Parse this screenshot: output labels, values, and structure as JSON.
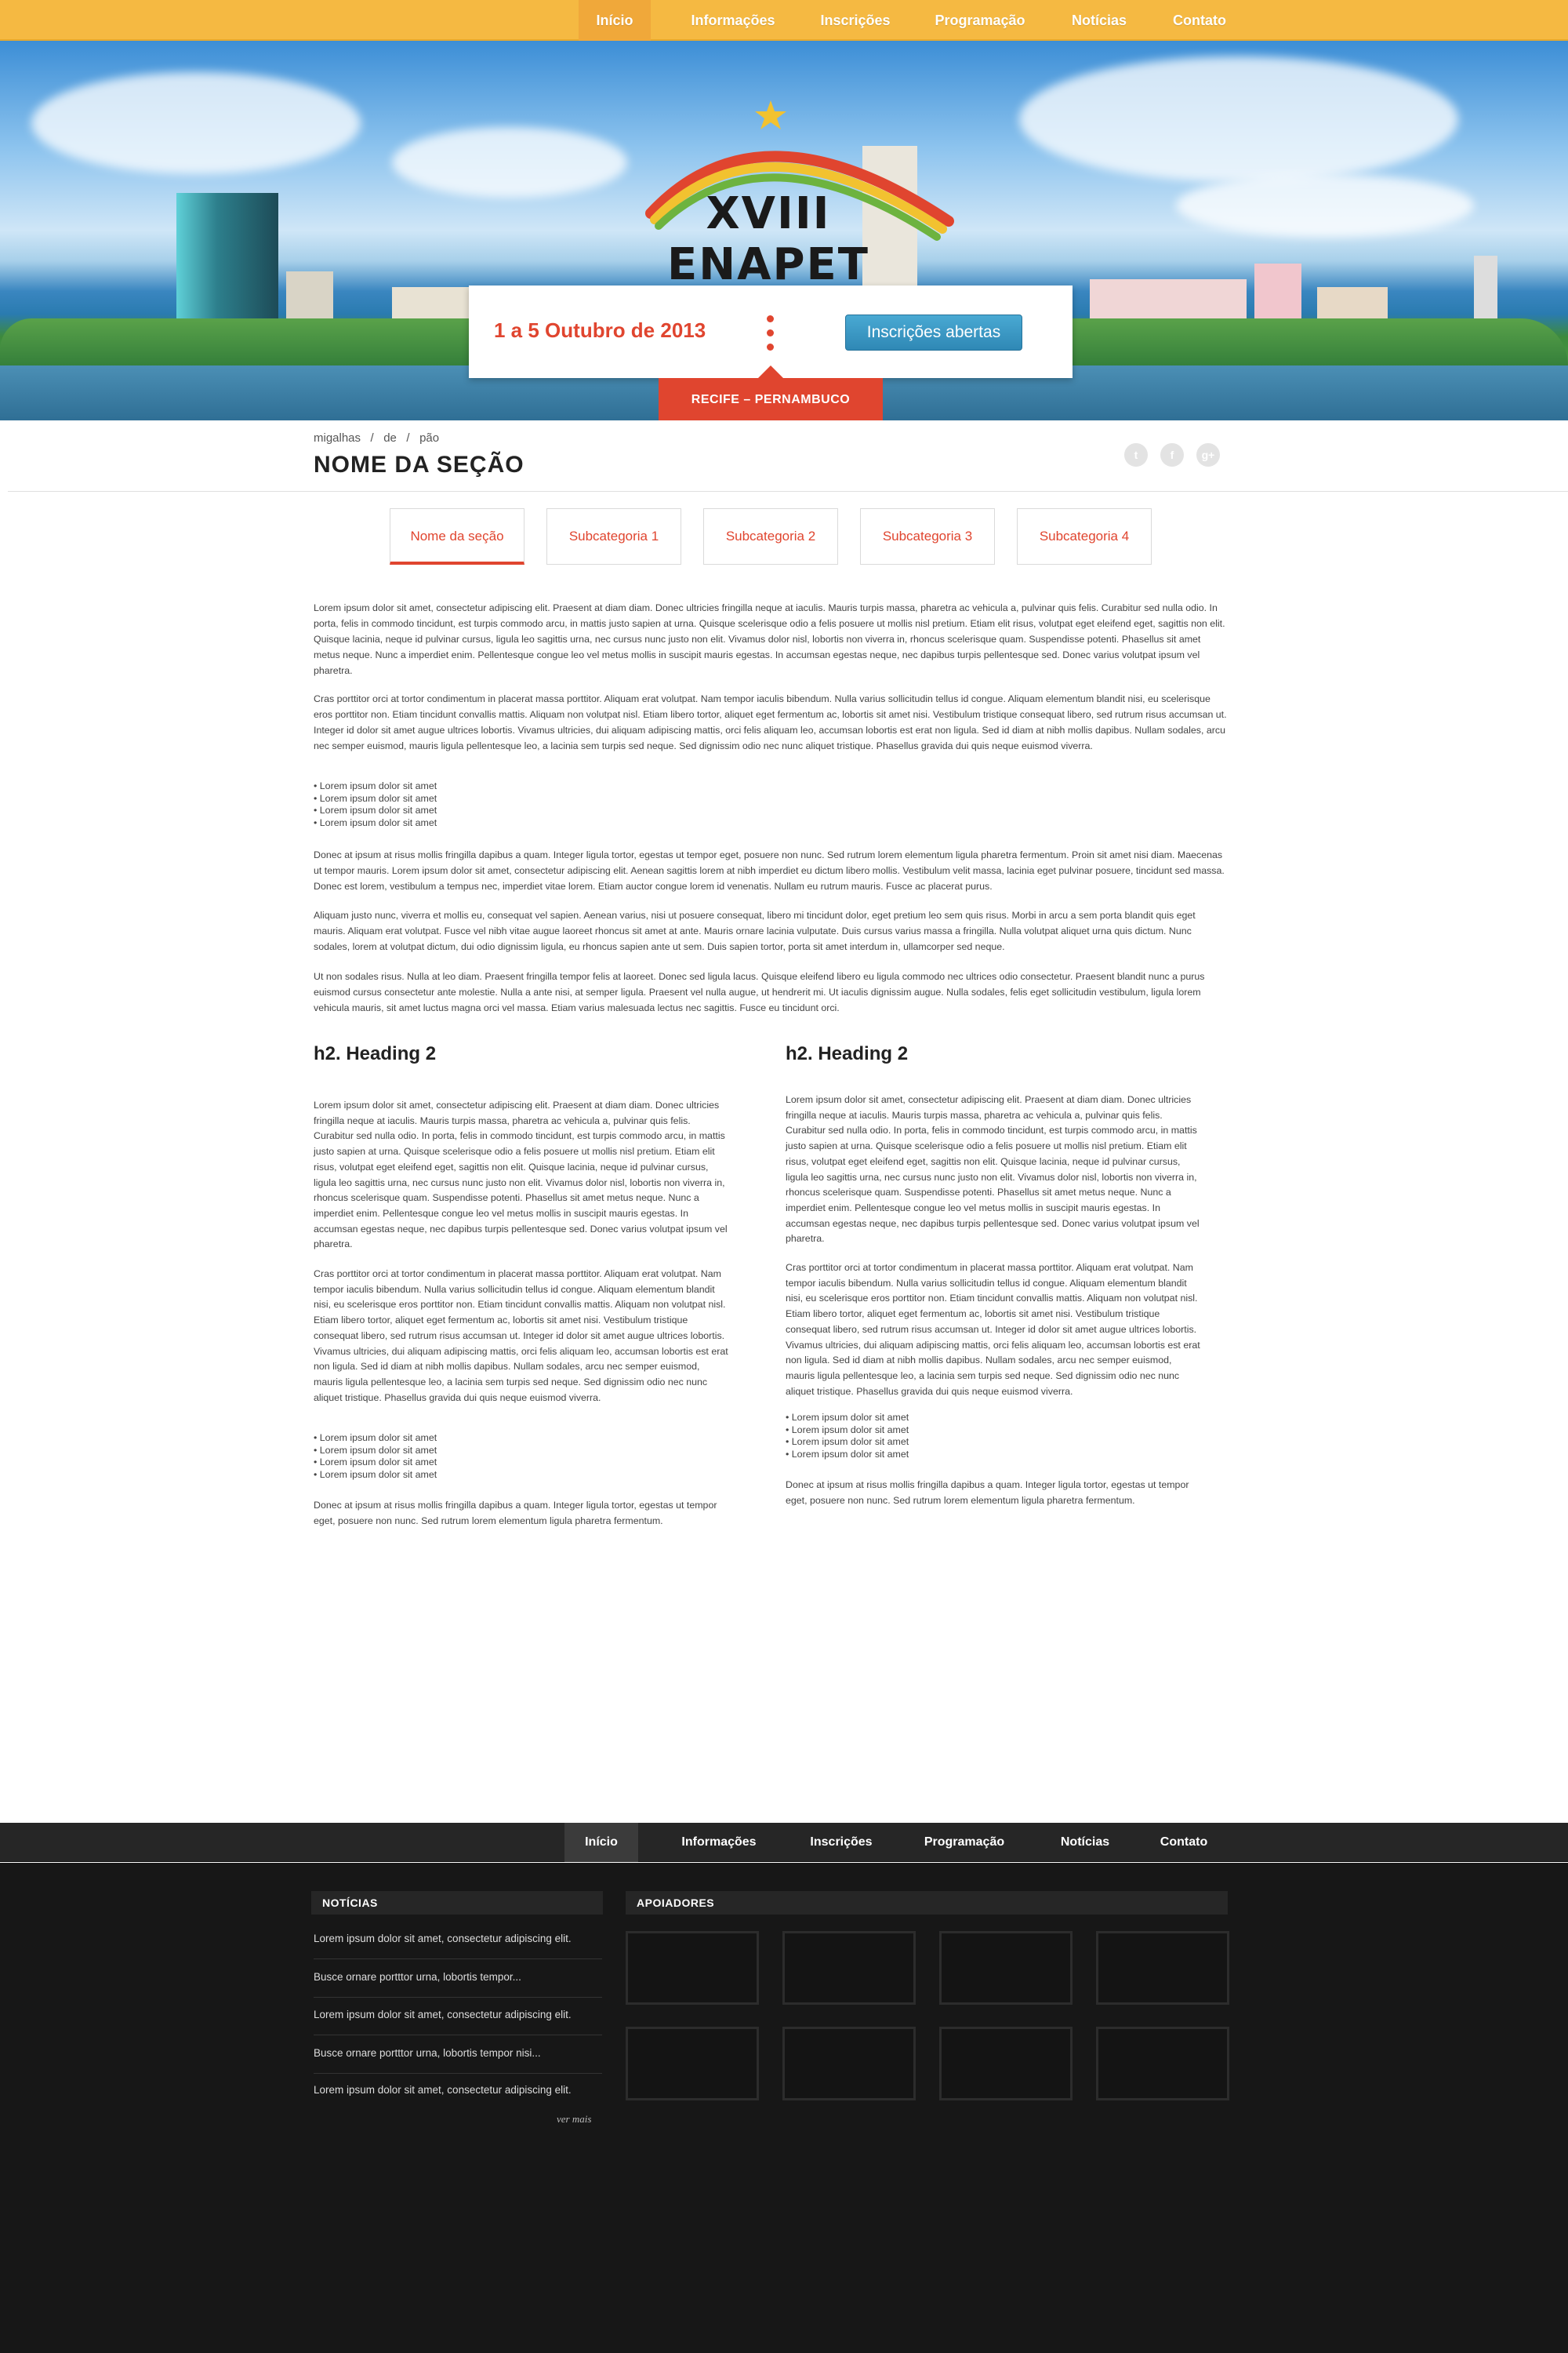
{
  "nav": [
    {
      "label": "Início",
      "active": true
    },
    {
      "label": "Informações"
    },
    {
      "label": "Inscrições"
    },
    {
      "label": "Programação"
    },
    {
      "label": "Notícias"
    },
    {
      "label": "Contato"
    }
  ],
  "hero": {
    "logo_text": "XVIII ENAPET",
    "date": "1 a 5 Outubro de 2013",
    "cta": "Inscrições abertas",
    "location": "RECIFE – PERNAMBUCO"
  },
  "breadcrumb": [
    "migalhas",
    "de",
    "pão"
  ],
  "section_title": "NOME DA SEÇÃO",
  "social_icons": [
    "twitter-icon",
    "facebook-icon",
    "googleplus-icon"
  ],
  "tabs": [
    "Nome da seção",
    "Subcategoria 1",
    "Subcategoria 2",
    "Subcategoria 3",
    "Subcategoria 4"
  ],
  "body": {
    "p1": "Lorem ipsum dolor sit amet, consectetur adipiscing elit. Praesent at diam diam. Donec ultricies fringilla neque at iaculis. Mauris turpis massa, pharetra ac vehicula a, pulvinar quis felis. Curabitur sed nulla odio. In porta, felis in commodo tincidunt, est turpis commodo arcu, in mattis justo sapien at urna. Quisque scelerisque odio a felis posuere ut mollis nisl pretium. Etiam elit risus, volutpat eget eleifend eget, sagittis non elit. Quisque lacinia, neque id pulvinar cursus, ligula leo sagittis urna, nec cursus nunc justo non elit. Vivamus dolor nisl, lobortis non viverra in, rhoncus scelerisque quam. Suspendisse potenti. Phasellus sit amet metus neque. Nunc a imperdiet enim. Pellentesque congue leo vel metus mollis in suscipit mauris egestas. In accumsan egestas neque, nec dapibus turpis pellentesque sed. Donec varius volutpat ipsum vel pharetra.",
    "p2": "Cras porttitor orci at tortor condimentum in placerat massa porttitor. Aliquam erat volutpat. Nam tempor iaculis bibendum. Nulla varius sollicitudin tellus id congue. Aliquam elementum blandit nisi, eu scelerisque eros porttitor non. Etiam tincidunt convallis mattis. Aliquam non volutpat nisl. Etiam libero tortor, aliquet eget fermentum ac, lobortis sit amet nisi. Vestibulum tristique consequat libero, sed rutrum risus accumsan ut. Integer id dolor sit amet augue ultrices lobortis. Vivamus ultricies, dui aliquam adipiscing mattis, orci felis aliquam leo, accumsan lobortis est erat non ligula. Sed id diam at nibh mollis dapibus. Nullam sodales, arcu nec semper euismod, mauris ligula pellentesque leo, a lacinia sem turpis sed neque. Sed dignissim odio nec nunc aliquet tristique. Phasellus gravida dui quis neque euismod viverra.",
    "bullets": [
      "• Lorem ipsum dolor sit amet",
      "• Lorem ipsum dolor sit amet",
      "• Lorem ipsum dolor sit amet",
      "• Lorem ipsum dolor sit amet"
    ],
    "p3": "Donec at ipsum at risus mollis fringilla dapibus a quam. Integer ligula tortor, egestas ut tempor eget, posuere non nunc. Sed rutrum lorem elementum ligula pharetra fermentum. Proin sit amet nisi diam. Maecenas ut tempor mauris. Lorem ipsum dolor sit amet, consectetur adipiscing elit. Aenean sagittis lorem at nibh imperdiet eu dictum libero mollis. Vestibulum velit massa, lacinia eget pulvinar posuere, tincidunt sed massa. Donec est lorem, vestibulum a tempus nec, imperdiet vitae lorem. Etiam auctor congue lorem id venenatis. Nullam eu rutrum mauris. Fusce ac placerat purus.",
    "p4": "Aliquam justo nunc, viverra et mollis eu, consequat vel sapien. Aenean varius, nisi ut posuere consequat, libero mi tincidunt dolor, eget pretium leo sem quis risus. Morbi in arcu a sem porta blandit quis eget mauris. Aliquam erat volutpat. Fusce vel nibh vitae augue laoreet rhoncus sit amet at ante. Mauris ornare lacinia vulputate. Duis cursus varius massa a fringilla. Nulla volutpat aliquet urna quis dictum. Nunc sodales, lorem at volutpat dictum, dui odio dignissim ligula, eu rhoncus sapien ante ut sem. Duis sapien tortor, porta sit amet interdum in, ullamcorper sed neque.",
    "p5": "Ut non sodales risus. Nulla at leo diam. Praesent fringilla tempor felis at laoreet. Donec sed ligula lacus. Quisque eleifend libero eu ligula commodo nec ultrices odio consectetur. Praesent blandit nunc a purus euismod cursus consectetur ante molestie. Nulla a ante nisi, at semper ligula. Praesent vel nulla augue, ut hendrerit mi. Ut iaculis dignissim augue. Nulla sodales, felis eget sollicitudin vestibulum, ligula lorem vehicula mauris, sit amet luctus magna orci vel massa. Etiam varius malesuada lectus nec sagittis. Fusce eu tincidunt orci."
  },
  "columns": [
    {
      "heading": "h2. Heading 2",
      "p1": "Lorem ipsum dolor sit amet, consectetur adipiscing elit. Praesent at diam diam. Donec ultricies fringilla neque at iaculis. Mauris turpis massa, pharetra ac vehicula a, pulvinar quis felis. Curabitur sed nulla odio. In porta, felis in commodo tincidunt, est turpis commodo arcu, in mattis justo sapien at urna. Quisque scelerisque odio a felis posuere ut mollis nisl pretium. Etiam elit risus, volutpat eget eleifend eget, sagittis non elit. Quisque lacinia, neque id pulvinar cursus, ligula leo sagittis urna, nec cursus nunc justo non elit. Vivamus dolor nisl, lobortis non viverra in, rhoncus scelerisque quam. Suspendisse potenti. Phasellus sit amet metus neque. Nunc a imperdiet enim. Pellentesque congue leo vel metus mollis in suscipit mauris egestas. In accumsan egestas neque, nec dapibus turpis pellentesque sed. Donec varius volutpat ipsum vel pharetra.",
      "p2": "Cras porttitor orci at tortor condimentum in placerat massa porttitor. Aliquam erat volutpat. Nam tempor iaculis bibendum. Nulla varius sollicitudin tellus id congue. Aliquam elementum blandit nisi, eu scelerisque eros porttitor non. Etiam tincidunt convallis mattis. Aliquam non volutpat nisl. Etiam libero tortor, aliquet eget fermentum ac, lobortis sit amet nisi. Vestibulum tristique consequat libero, sed rutrum risus accumsan ut. Integer id dolor sit amet augue ultrices lobortis. Vivamus ultricies, dui aliquam adipiscing mattis, orci felis aliquam leo, accumsan lobortis est erat non ligula. Sed id diam at nibh mollis dapibus. Nullam sodales, arcu nec semper euismod, mauris ligula pellentesque leo, a lacinia sem turpis sed neque. Sed dignissim odio nec nunc aliquet tristique. Phasellus gravida dui quis neque euismod viverra.",
      "bullets": [
        "• Lorem ipsum dolor sit amet",
        "• Lorem ipsum dolor sit amet",
        "• Lorem ipsum dolor sit amet",
        "• Lorem ipsum dolor sit amet"
      ],
      "p3": "Donec at ipsum at risus mollis fringilla dapibus a quam. Integer ligula tortor, egestas ut tempor eget, posuere non nunc. Sed rutrum lorem elementum ligula pharetra fermentum."
    },
    {
      "heading": "h2. Heading 2",
      "p1": "Lorem ipsum dolor sit amet, consectetur adipiscing elit. Praesent at diam diam. Donec ultricies fringilla neque at iaculis. Mauris turpis massa, pharetra ac vehicula a, pulvinar quis felis. Curabitur sed nulla odio. In porta, felis in commodo tincidunt, est turpis commodo arcu, in mattis justo sapien at urna. Quisque scelerisque odio a felis posuere ut mollis nisl pretium. Etiam elit risus, volutpat eget eleifend eget, sagittis non elit. Quisque lacinia, neque id pulvinar cursus, ligula leo sagittis urna, nec cursus nunc justo non elit. Vivamus dolor nisl, lobortis non viverra in, rhoncus scelerisque quam. Suspendisse potenti. Phasellus sit amet metus neque. Nunc a imperdiet enim. Pellentesque congue leo vel metus mollis in suscipit mauris egestas. In accumsan egestas neque, nec dapibus turpis pellentesque sed. Donec varius volutpat ipsum vel pharetra.",
      "p2": "Cras porttitor orci at tortor condimentum in placerat massa porttitor. Aliquam erat volutpat. Nam tempor iaculis bibendum. Nulla varius sollicitudin tellus id congue. Aliquam elementum blandit nisi, eu scelerisque eros porttitor non. Etiam tincidunt convallis mattis. Aliquam non volutpat nisl. Etiam libero tortor, aliquet eget fermentum ac, lobortis sit amet nisi. Vestibulum tristique consequat libero, sed rutrum risus accumsan ut. Integer id dolor sit amet augue ultrices lobortis. Vivamus ultricies, dui aliquam adipiscing mattis, orci felis aliquam leo, accumsan lobortis est erat non ligula. Sed id diam at nibh mollis dapibus. Nullam sodales, arcu nec semper euismod, mauris ligula pellentesque leo, a lacinia sem turpis sed neque. Sed dignissim odio nec nunc aliquet tristique. Phasellus gravida dui quis neque euismod viverra.",
      "bullets": [
        "• Lorem ipsum dolor sit amet",
        "• Lorem ipsum dolor sit amet",
        "• Lorem ipsum dolor sit amet",
        "• Lorem ipsum dolor sit amet"
      ],
      "p3": "Donec at ipsum at risus mollis fringilla dapibus a quam. Integer ligula tortor, egestas ut tempor eget, posuere non nunc. Sed rutrum lorem elementum ligula pharetra fermentum."
    }
  ],
  "footer_nav": [
    {
      "label": "Início",
      "active": true
    },
    {
      "label": "Informações"
    },
    {
      "label": "Inscrições"
    },
    {
      "label": "Programação"
    },
    {
      "label": "Notícias"
    },
    {
      "label": "Contato"
    }
  ],
  "footer": {
    "news_heading": "NOTÍCIAS",
    "news": [
      "Lorem ipsum dolor sit amet, consectetur adipiscing elit.",
      "Busce ornare portttor urna, lobortis tempor...",
      "Lorem ipsum dolor sit amet, consectetur adipiscing elit.",
      "Busce ornare portttor urna, lobortis tempor nisi...",
      "Lorem ipsum dolor sit amet, consectetur adipiscing elit."
    ],
    "more": "ver mais",
    "sponsors_heading": "APOIADORES"
  },
  "colors": {
    "brand_orange": "#f5b942",
    "accent_red": "#e0452f",
    "button_blue": "#3a97c4",
    "footer_dark": "#171717"
  }
}
